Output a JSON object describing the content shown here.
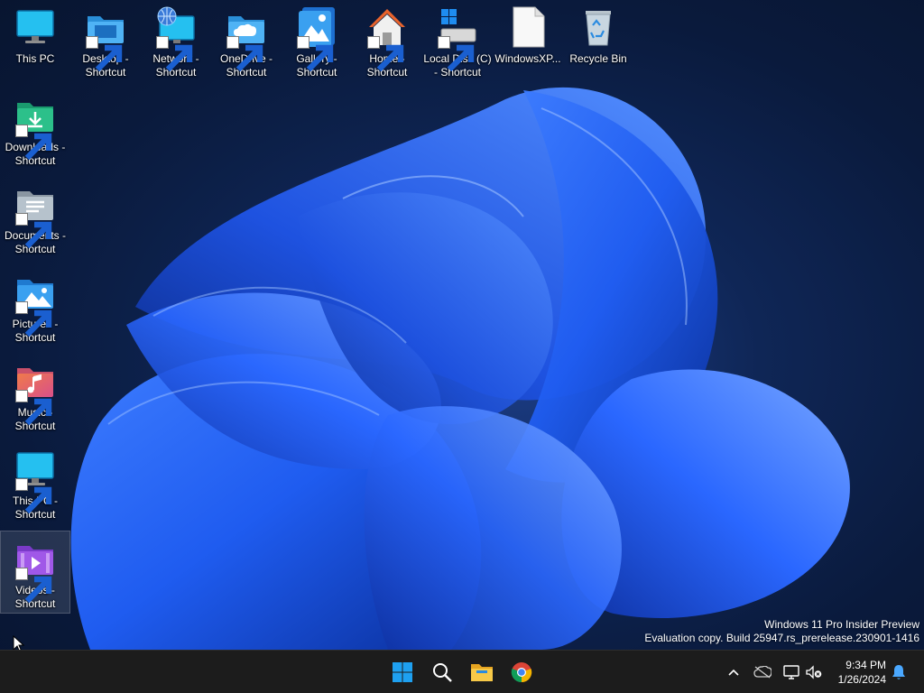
{
  "desktop": {
    "icons_top": [
      {
        "name": "this-pc",
        "label": "This PC"
      },
      {
        "name": "desktop-shortcut",
        "label": "Desktop -\nShortcut"
      },
      {
        "name": "network-shortcut",
        "label": "Network -\nShortcut"
      },
      {
        "name": "onedrive-shortcut",
        "label": "OneDrive -\nShortcut"
      },
      {
        "name": "gallery-shortcut",
        "label": "Gallery -\nShortcut"
      },
      {
        "name": "home-shortcut",
        "label": "Home -\nShortcut"
      },
      {
        "name": "local-disk-shortcut",
        "label": "Local Disk (C)\n- Shortcut"
      },
      {
        "name": "windowsxp-file",
        "label": "WindowsXP..."
      },
      {
        "name": "recycle-bin",
        "label": "Recycle Bin"
      }
    ],
    "icons_left": [
      {
        "name": "downloads-shortcut",
        "label": "Downloads -\nShortcut"
      },
      {
        "name": "documents-shortcut",
        "label": "Documents -\nShortcut"
      },
      {
        "name": "pictures-shortcut",
        "label": "Pictures -\nShortcut"
      },
      {
        "name": "music-shortcut",
        "label": "Music -\nShortcut"
      },
      {
        "name": "this-pc-shortcut",
        "label": "This PC -\nShortcut"
      },
      {
        "name": "videos-shortcut",
        "label": "Videos -\nShortcut"
      }
    ]
  },
  "watermark": {
    "line1": "Windows 11 Pro Insider Preview",
    "line2": "Evaluation copy. Build 25947.rs_prerelease.230901-1416"
  },
  "taskbar": {
    "pinned": [
      "start-icon",
      "search-icon",
      "file-explorer-icon",
      "chrome-icon"
    ],
    "tray_icons": [
      "chevron-up-icon",
      "onedrive-offline-icon",
      "network-icon",
      "volume-muted-icon",
      "notification-bell-icon"
    ],
    "time": "9:34 PM",
    "date": "1/26/2024"
  },
  "colors": {
    "taskbar": "#1c1c1c",
    "folder_blue": "#3aa0e8",
    "accent": "#0078d4"
  }
}
